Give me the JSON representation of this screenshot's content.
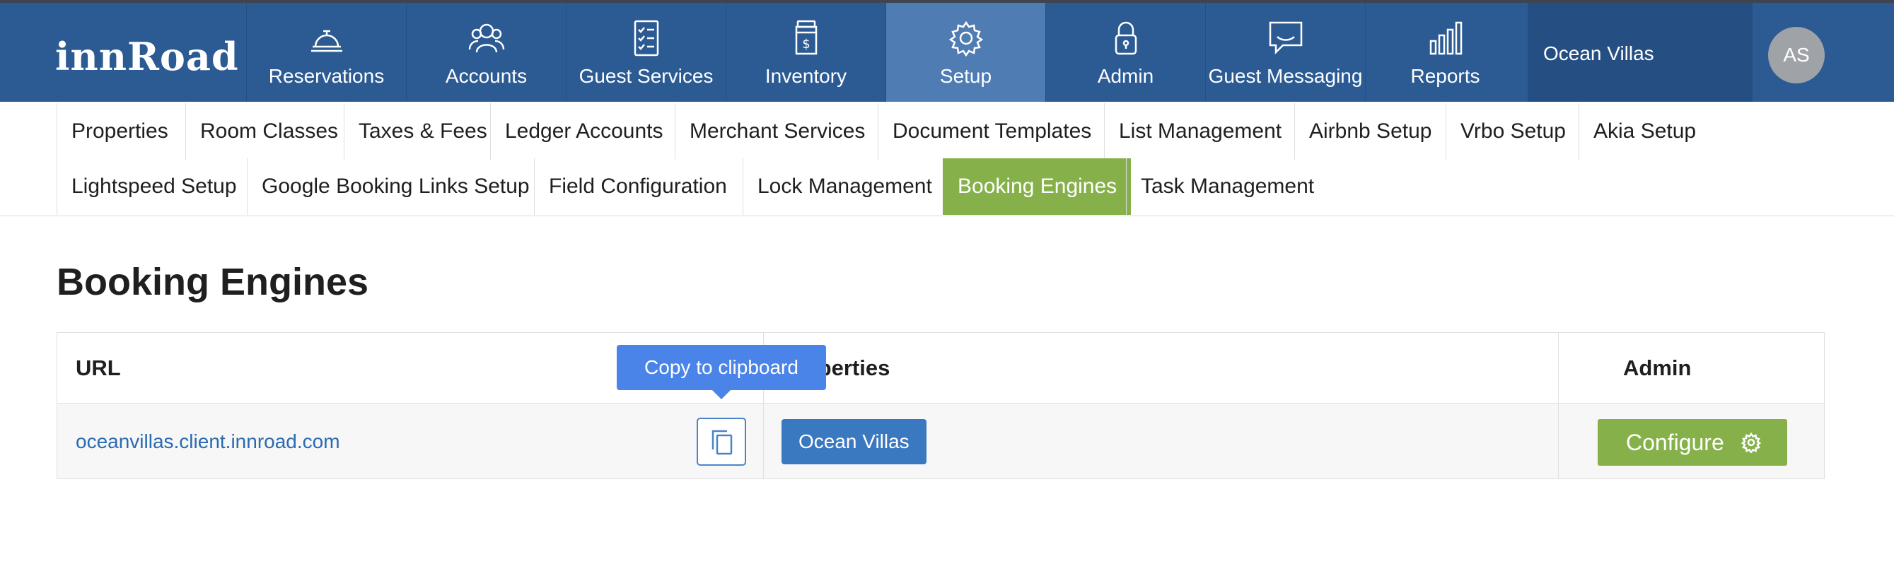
{
  "brand": {
    "logo_text": "innRoad"
  },
  "topnav": {
    "items": [
      {
        "label": "Reservations",
        "icon": "bell-icon"
      },
      {
        "label": "Accounts",
        "icon": "people-icon"
      },
      {
        "label": "Guest Services",
        "icon": "checklist-icon"
      },
      {
        "label": "Inventory",
        "icon": "dollar-jar-icon"
      },
      {
        "label": "Setup",
        "icon": "gear-icon",
        "active": true
      },
      {
        "label": "Admin",
        "icon": "lock-icon"
      },
      {
        "label": "Guest Messaging",
        "icon": "message-icon"
      },
      {
        "label": "Reports",
        "icon": "bar-chart-icon"
      }
    ],
    "property": "Ocean Villas",
    "avatar_initials": "AS"
  },
  "subnav": {
    "items": [
      "Properties",
      "Room Classes",
      "Taxes & Fees",
      "Ledger Accounts",
      "Merchant Services",
      "Document Templates",
      "List Management",
      "Airbnb Setup",
      "Vrbo Setup",
      "Akia Setup",
      "Lightspeed Setup",
      "Google Booking Links Setup",
      "Field Configuration",
      "Lock Management",
      "Booking Engines",
      "Task Management"
    ],
    "active": "Booking Engines"
  },
  "page": {
    "title": "Booking Engines"
  },
  "table": {
    "headers": {
      "url": "URL",
      "properties": "Properties",
      "admin": "Admin"
    },
    "rows": [
      {
        "url": "oceanvillas.client.innroad.com",
        "property": "Ocean Villas",
        "action": "Configure"
      }
    ]
  },
  "tooltip": {
    "text": "Copy to clipboard"
  },
  "colors": {
    "header_bg": "#2c5b93",
    "active_nav": "#4f7cb3",
    "green": "#86b14a",
    "chip_blue": "#3a78bf",
    "tooltip_blue": "#4a84e8"
  }
}
